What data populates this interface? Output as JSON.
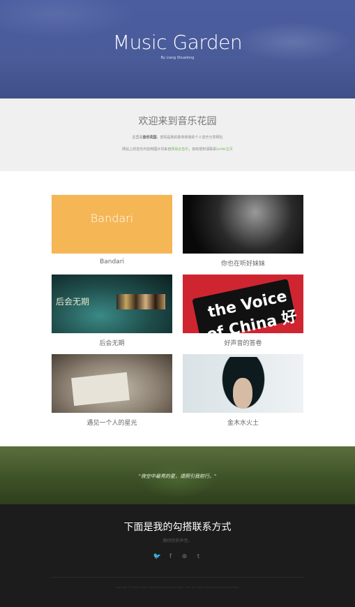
{
  "hero": {
    "title": "Music Garden",
    "subtitle": "By Liang Shuailong"
  },
  "welcome": {
    "heading": "欢迎来到音乐花园",
    "line1_prefix": "这里是",
    "line1_bold": "音乐花园",
    "line1_suffix": "，密码是我的歌单和我的个人音乐分享网址",
    "line2_prefix": "网站上的音乐内容和图片均来自",
    "line2_link1": "网易云音乐",
    "line2_mid": "，如有侵权请联系",
    "line2_link2": "Linfei主页"
  },
  "gallery": [
    {
      "caption": "Bandari",
      "thumb_text": "Bandari"
    },
    {
      "caption": "你也在听好妹妹"
    },
    {
      "caption": "后会无期",
      "thumb_text": "后会无期"
    },
    {
      "caption": "好声音的答卷",
      "thumb_text": "the Voice of China 好声音"
    },
    {
      "caption": "遇见一个人的星光"
    },
    {
      "caption": "金木水火土"
    }
  ],
  "quote": {
    "text": "\"夜空中最亮的星，请照引我前行。\""
  },
  "footer": {
    "heading": "下面是我的勾搭联系方式",
    "sub": "期待你的声音。",
    "social_icons": [
      "twitter-icon",
      "facebook-icon",
      "dribbble-icon",
      "tumblr-icon"
    ],
    "social_glyphs": [
      "🐦",
      "f",
      "⊛",
      "t"
    ],
    "copyright": "Copyright © MUSIC.ZONE. Designed by Linfei Template. 2014. All rights reserved by Liang Shuailong."
  },
  "colors": {
    "hero_bg": "#4a5b99",
    "welcome_bg": "#f0f0f0",
    "bandari_thumb": "#f5b656",
    "voice_thumb": "#cf2531",
    "footer_bg": "#1c1c1c",
    "link": "#7ab55c"
  }
}
